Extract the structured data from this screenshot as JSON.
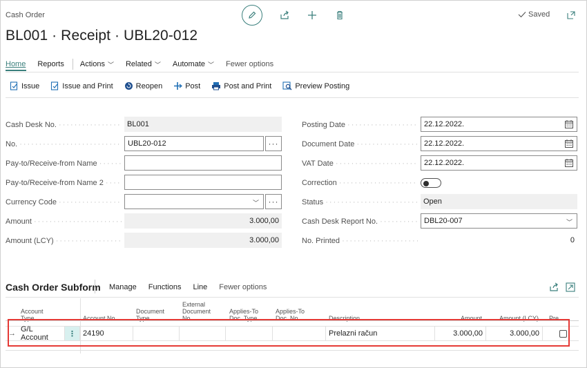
{
  "header": {
    "breadcrumb": "Cash Order",
    "title": "BL001 · Receipt · UBL20-012",
    "saved_label": "Saved"
  },
  "menu": {
    "home": "Home",
    "reports": "Reports",
    "actions": "Actions",
    "related": "Related",
    "automate": "Automate",
    "fewer": "Fewer options"
  },
  "toolbar": {
    "issue": "Issue",
    "issue_print": "Issue and Print",
    "reopen": "Reopen",
    "post": "Post",
    "post_print": "Post and Print",
    "preview": "Preview Posting"
  },
  "form": {
    "cash_desk_no": {
      "label": "Cash Desk No.",
      "value": "BL001"
    },
    "no": {
      "label": "No.",
      "value": "UBL20-012"
    },
    "pay_to_name": {
      "label": "Pay-to/Receive-from Name",
      "value": ""
    },
    "pay_to_name2": {
      "label": "Pay-to/Receive-from Name 2",
      "value": ""
    },
    "currency_code": {
      "label": "Currency Code",
      "value": ""
    },
    "amount": {
      "label": "Amount",
      "value": "3.000,00"
    },
    "amount_lcy": {
      "label": "Amount (LCY)",
      "value": "3.000,00"
    },
    "posting_date": {
      "label": "Posting Date",
      "value": "22.12.2022."
    },
    "document_date": {
      "label": "Document Date",
      "value": "22.12.2022."
    },
    "vat_date": {
      "label": "VAT Date",
      "value": "22.12.2022."
    },
    "correction": {
      "label": "Correction",
      "value": false
    },
    "status": {
      "label": "Status",
      "value": "Open"
    },
    "report_no": {
      "label": "Cash Desk Report No.",
      "value": "DBL20-007"
    },
    "no_printed": {
      "label": "No. Printed",
      "value": "0"
    }
  },
  "subform": {
    "title": "Cash Order Subform",
    "menu": {
      "manage": "Manage",
      "functions": "Functions",
      "line": "Line",
      "fewer": "Fewer options"
    },
    "columns": {
      "account_type": [
        "Account",
        "Type"
      ],
      "account_no": "Account No.",
      "document_type": [
        "Document",
        "Type"
      ],
      "external_doc": [
        "External",
        "Document",
        "No."
      ],
      "applies_to_type": [
        "Applies-To",
        "Doc. Type"
      ],
      "applies_to_no": [
        "Applies-To",
        "Doc. No."
      ],
      "description": "Description",
      "amount": "Amount",
      "amount_lcy": "Amount (LCY)",
      "pre": "Pre"
    },
    "rows": [
      {
        "account_type": "G/L Account",
        "account_no": "24190",
        "description": "Prelazni račun",
        "amount": "3.000,00",
        "amount_lcy": "3.000,00"
      }
    ]
  },
  "colors": {
    "accent": "#3a7f7c",
    "highlight": "#e53935"
  }
}
